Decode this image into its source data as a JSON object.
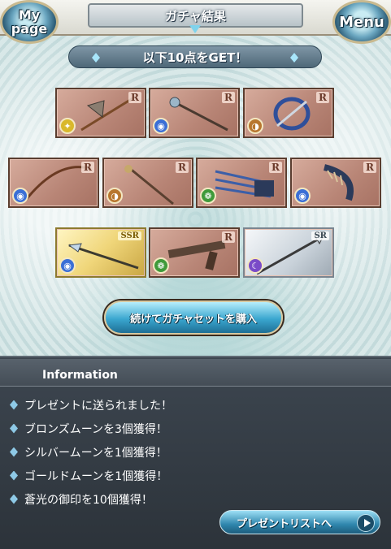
{
  "header": {
    "title": "ガチャ結果",
    "mypage_label": "My page",
    "menu_label": "Menu"
  },
  "result_banner": "以下10点をGET！",
  "items": [
    {
      "rarity": "R",
      "element": "light",
      "weapon": "axe"
    },
    {
      "rarity": "R",
      "element": "water",
      "weapon": "staff"
    },
    {
      "rarity": "R",
      "element": "earth",
      "weapon": "katana"
    },
    {
      "rarity": "R",
      "element": "water",
      "weapon": "bow"
    },
    {
      "rarity": "R",
      "element": "earth",
      "weapon": "staff"
    },
    {
      "rarity": "R",
      "element": "wind",
      "weapon": "gauntlet"
    },
    {
      "rarity": "R",
      "element": "water",
      "weapon": "gauntlet"
    },
    {
      "rarity": "SSR",
      "element": "water",
      "weapon": "spear"
    },
    {
      "rarity": "R",
      "element": "wind",
      "weapon": "gun"
    },
    {
      "rarity": "SR",
      "element": "dark",
      "weapon": "spear"
    }
  ],
  "element_colors": {
    "light": "#d9b82b",
    "water": "#3b6fd6",
    "earth": "#b8772f",
    "wind": "#3f9a3a",
    "dark": "#7a4bc8"
  },
  "continue_button": "続けてガチャセットを購入",
  "information": {
    "title": "Information",
    "messages": [
      "プレゼントに送られました！",
      "ブロンズムーンを3個獲得！",
      "シルバームーンを1個獲得！",
      "ゴールドムーンを1個獲得！",
      "蒼光の御印を10個獲得！"
    ]
  },
  "present_list_button": "プレゼントリストへ"
}
